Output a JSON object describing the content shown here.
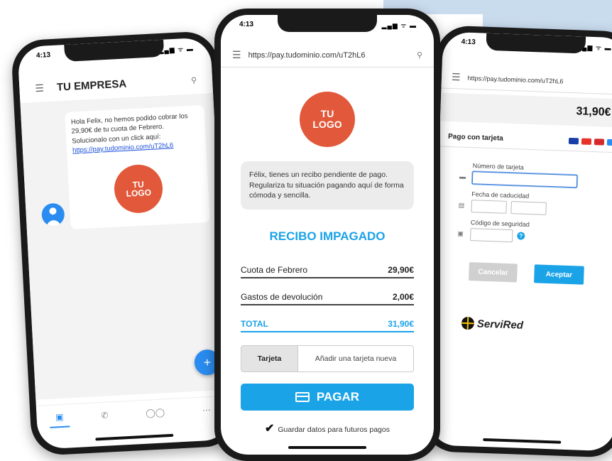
{
  "phone1": {
    "status_time": "4:13",
    "status_icons": "▂▄▆ ᯤ ▬",
    "header_title": "TU EMPRESA",
    "sms_text": "Hola Felix, no hemos podido cobrar los 29,90€ de tu cuota de Febrero. Solucionalo con un click aquí:",
    "sms_link": "https://pay.tudominio.com/uT2hL6",
    "logo_text": "TU LOGO",
    "fab_label": "+"
  },
  "phone2": {
    "status_time": "4:13",
    "status_icons": "▂▄▆ ᯤ ▬",
    "url": "https://pay.tudominio.com/uT2hL6",
    "logo_text": "TU LOGO",
    "message": "Félix, tienes un recibo pendiente de pago. Regulariza tu situación pagando aquí de forma cómoda y sencilla.",
    "recibo_title": "RECIBO IMPAGADO",
    "items": [
      {
        "label": "Cuota de Febrero",
        "amount": "29,90€"
      },
      {
        "label": "Gastos de devolución",
        "amount": "2,00€"
      }
    ],
    "total_label": "TOTAL",
    "total_amount": "31,90€",
    "card_tab": "Tarjeta",
    "add_card": "Añadir una tarjeta nueva",
    "pay_button": "PAGAR",
    "save_check": "✔",
    "save_text": "Guardar datos para futuros pagos"
  },
  "phone3": {
    "status_time": "4:13",
    "status_icons": "▂▄▆ ᯤ ▬",
    "url": "https://pay.tudominio.com/uT2hL6",
    "total": "31,90€",
    "pago_title": "Pago con tarjeta",
    "card_number_label": "Número de tarjeta",
    "expiry_label": "Fecha de caducidad",
    "security_label": "Código de seguridad",
    "help": "?",
    "cancel_button": "Cancelar",
    "accept_button": "Aceptar",
    "brand": "ServiRed",
    "colors": {
      "visa": "#1a3fa8",
      "mastercard": "#e8332a",
      "maestro": "#d42a2a",
      "amex": "#2a8cf0"
    }
  }
}
